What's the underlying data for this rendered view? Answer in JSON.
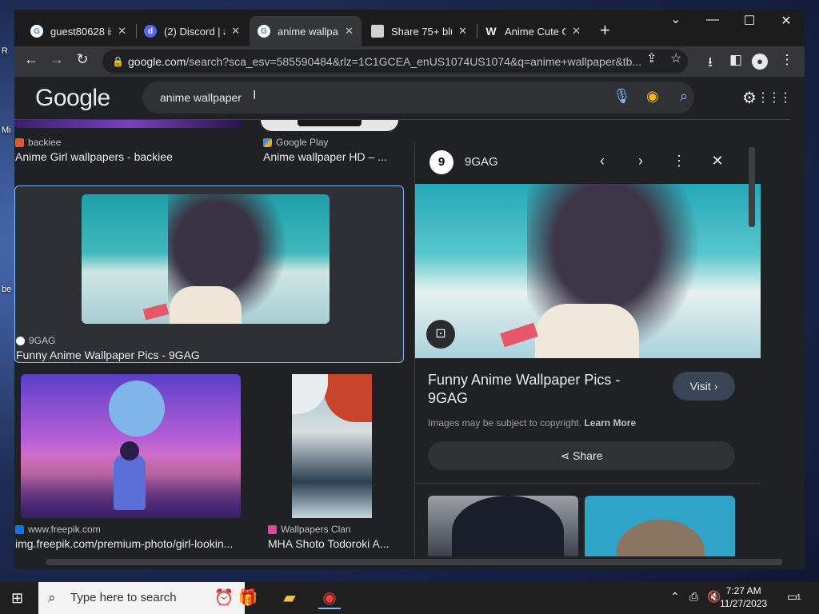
{
  "desktop": {
    "labels": [
      "R",
      "Mi",
      "be"
    ]
  },
  "tabs": [
    {
      "title": "guest80628 is",
      "favicon": "google-icon"
    },
    {
      "title": "(2) Discord | #",
      "favicon": "discord-icon"
    },
    {
      "title": "anime wallpap",
      "favicon": "google-icon",
      "active": true
    },
    {
      "title": "Share 75+ blu",
      "favicon": "page-icon"
    },
    {
      "title": "Anime Cute G",
      "favicon": "w-icon"
    }
  ],
  "address_bar": {
    "host": "google.com",
    "path": "/search?sca_esv=585590484&rlz=1C1GCEA_enUS1074US1074&q=anime+wallpaper&tb..."
  },
  "google": {
    "logo": "Google",
    "query": "anime wallpaper"
  },
  "results": {
    "top_row": [
      {
        "source": "backiee",
        "caption": "Anime Girl wallpapers - backiee"
      },
      {
        "source": "Google Play",
        "caption": "Anime wallpaper HD – ..."
      }
    ],
    "selected": {
      "source": "9GAG",
      "caption": "Funny Anime Wallpaper Pics - 9GAG"
    },
    "bottom_row": [
      {
        "source": "www.freepik.com",
        "caption": "img.freepik.com/premium-photo/girl-lookin..."
      },
      {
        "source": "Wallpapers Clan",
        "caption": "MHA Shoto Todoroki A..."
      }
    ]
  },
  "panel": {
    "logo_glyph": "9",
    "source": "9GAG",
    "title": "Funny Anime Wallpaper Pics - 9GAG",
    "visit_label": "Visit",
    "copyright": "Images may be subject to copyright.",
    "learn_more": "Learn More",
    "share_label": "Share"
  },
  "taskbar": {
    "search_placeholder": "Type here to search",
    "time": "7:27 AM",
    "date": "11/27/2023",
    "notification_count": "1"
  },
  "colors": {
    "accent": "#8ab4f8",
    "page_bg": "#202124",
    "tab_active": "#35363a"
  }
}
